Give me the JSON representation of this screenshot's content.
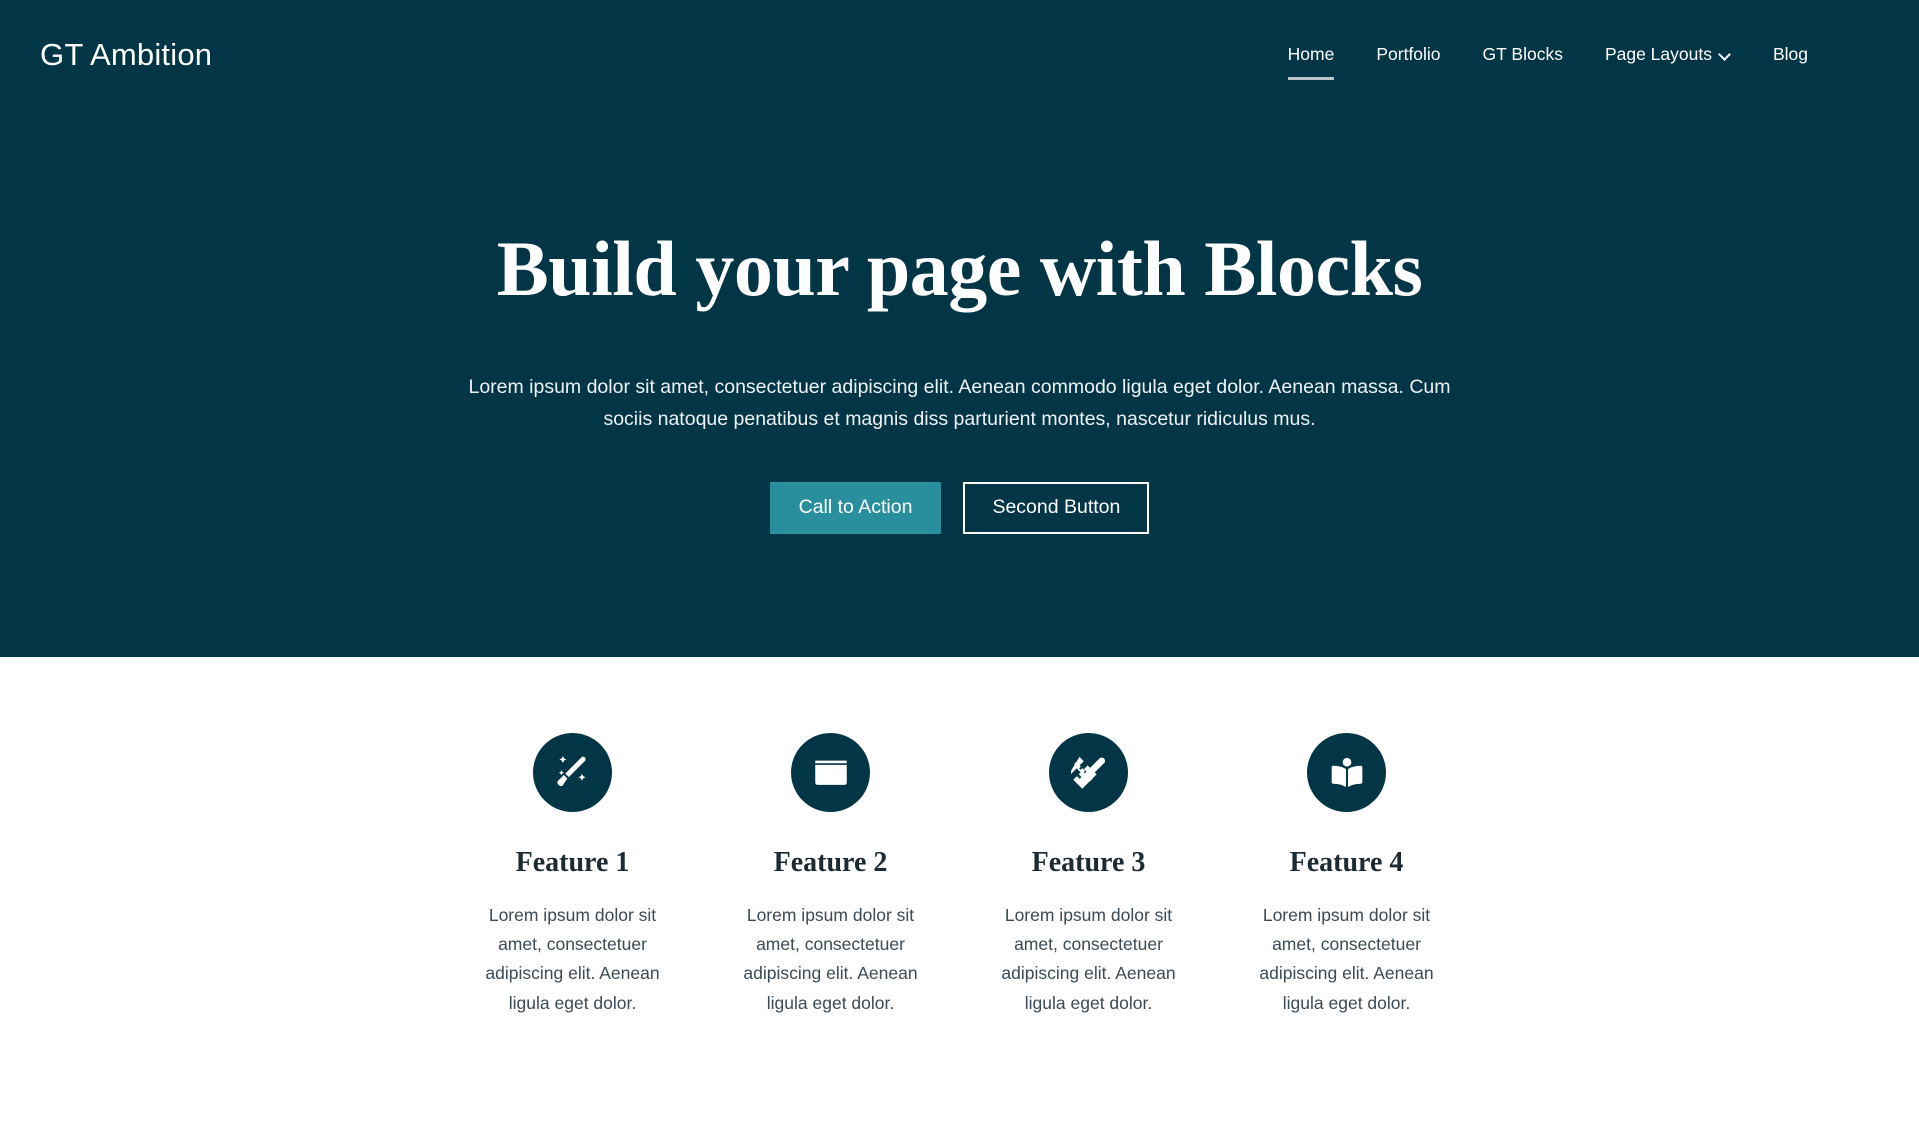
{
  "header": {
    "brand": "GT Ambition",
    "nav": [
      {
        "label": "Home",
        "active": true,
        "has_dropdown": false
      },
      {
        "label": "Portfolio",
        "active": false,
        "has_dropdown": false
      },
      {
        "label": "GT Blocks",
        "active": false,
        "has_dropdown": false
      },
      {
        "label": "Page Layouts",
        "active": false,
        "has_dropdown": true
      },
      {
        "label": "Blog",
        "active": false,
        "has_dropdown": false
      }
    ]
  },
  "hero": {
    "title": "Build your page with Blocks",
    "text": "Lorem ipsum dolor sit amet, consectetuer adipiscing elit. Aenean commodo ligula eget dolor. Aenean massa. Cum sociis natoque penatibus et magnis diss parturient montes, nascetur ridiculus mus.",
    "primary_button": "Call to Action",
    "secondary_button": "Second Button"
  },
  "features": [
    {
      "icon": "magic-wand-icon",
      "title": "Feature 1",
      "desc": "Lorem ipsum dolor sit amet, consectetuer adipiscing elit. Aenean ligula eget dolor."
    },
    {
      "icon": "id-card-icon",
      "title": "Feature 2",
      "desc": "Lorem ipsum dolor sit amet, consectetuer adipiscing elit. Aenean ligula eget dolor."
    },
    {
      "icon": "pencil-ruler-icon",
      "title": "Feature 3",
      "desc": "Lorem ipsum dolor sit amet, consectetuer adipiscing elit. Aenean ligula eget dolor."
    },
    {
      "icon": "book-reader-icon",
      "title": "Feature 4",
      "desc": "Lorem ipsum dolor sit amet, consectetuer adipiscing elit. Aenean ligula eget dolor."
    }
  ],
  "colors": {
    "hero_background": "#023545",
    "accent_teal": "#2a8f9d",
    "page_background": "#ffffff",
    "text_light": "#ffffff",
    "text_dark": "#1b2a33",
    "nav_underline": "#b9c5ca"
  }
}
